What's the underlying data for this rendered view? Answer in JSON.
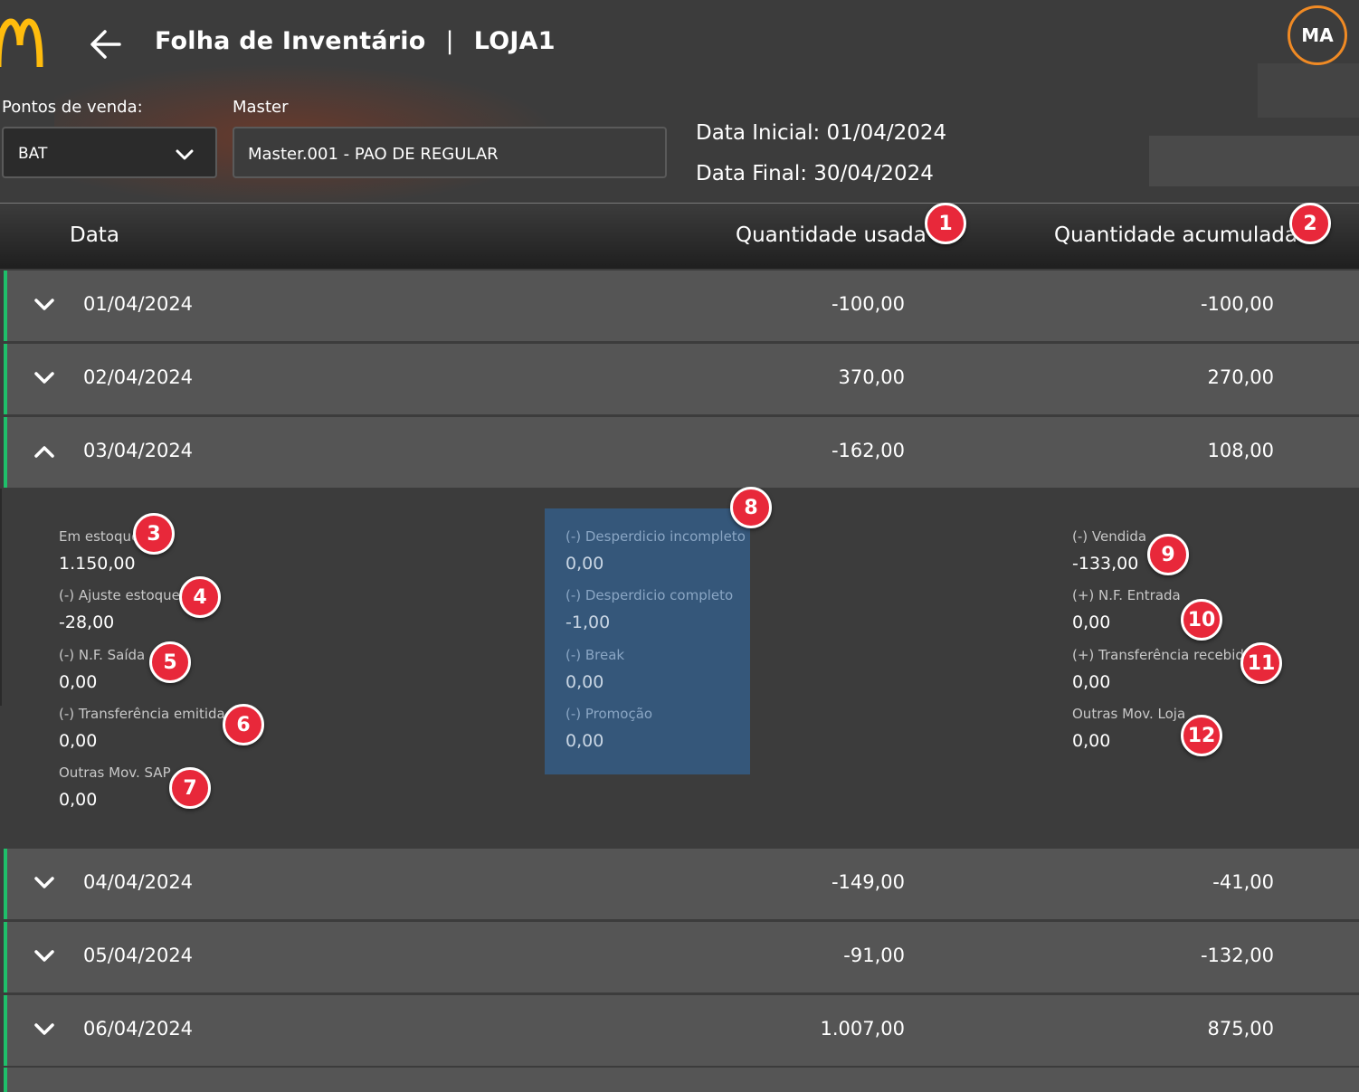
{
  "header": {
    "title": "Folha de Inventário",
    "separator": "|",
    "store": "LOJA1",
    "avatar_initials": "MA"
  },
  "filters": {
    "pos_label": "Pontos de venda:",
    "pos_value": "BAT",
    "master_label": "Master",
    "master_value": "Master.001 - PAO DE REGULAR",
    "start_date": "Data Inicial: 01/04/2024",
    "end_date": "Data Final: 30/04/2024"
  },
  "table": {
    "col_date": "Data",
    "col_used": "Quantidade usada",
    "col_accumulated": "Quantidade acumulada",
    "rows": [
      {
        "date": "01/04/2024",
        "used": "-100,00",
        "accumulated": "-100,00"
      },
      {
        "date": "02/04/2024",
        "used": "370,00",
        "accumulated": "270,00"
      },
      {
        "date": "03/04/2024",
        "used": "-162,00",
        "accumulated": "108,00"
      },
      {
        "date": "04/04/2024",
        "used": "-149,00",
        "accumulated": "-41,00"
      },
      {
        "date": "05/04/2024",
        "used": "-91,00",
        "accumulated": "-132,00"
      },
      {
        "date": "06/04/2024",
        "used": "1.007,00",
        "accumulated": "875,00"
      }
    ]
  },
  "detail": {
    "left": [
      {
        "label": "Em estoque",
        "value": "1.150,00"
      },
      {
        "label": "(-) Ajuste estoque",
        "value": "-28,00"
      },
      {
        "label": "(-) N.F. Saída",
        "value": "0,00"
      },
      {
        "label": "(-) Transferência emitida",
        "value": "0,00"
      },
      {
        "label": "Outras Mov. SAP",
        "value": "0,00"
      }
    ],
    "middle": [
      {
        "label": "(-) Desperdicio incompleto",
        "value": "0,00"
      },
      {
        "label": "(-) Desperdicio completo",
        "value": "-1,00"
      },
      {
        "label": "(-) Break",
        "value": "0,00"
      },
      {
        "label": "(-) Promoção",
        "value": "0,00"
      }
    ],
    "right": [
      {
        "label": "(-) Vendida",
        "value": "-133,00"
      },
      {
        "label": "(+) N.F. Entrada",
        "value": "0,00"
      },
      {
        "label": "(+) Transferência recebida",
        "value": "0,00"
      },
      {
        "label": "Outras Mov. Loja",
        "value": "0,00"
      }
    ]
  },
  "badges": [
    "1",
    "2",
    "3",
    "4",
    "5",
    "6",
    "7",
    "8",
    "9",
    "10",
    "11",
    "12"
  ],
  "colors": {
    "accent_green": "#1fbf6a",
    "badge_red": "#e8283a",
    "avatar_ring": "#f08a24",
    "logo_yellow": "#ffbc0d",
    "highlight_blue": "#35577a"
  },
  "icons": {
    "logo": "mcdonalds-arches-icon",
    "back": "arrow-left-icon",
    "collapsed": "chevron-down-icon",
    "expanded": "chevron-up-icon"
  }
}
